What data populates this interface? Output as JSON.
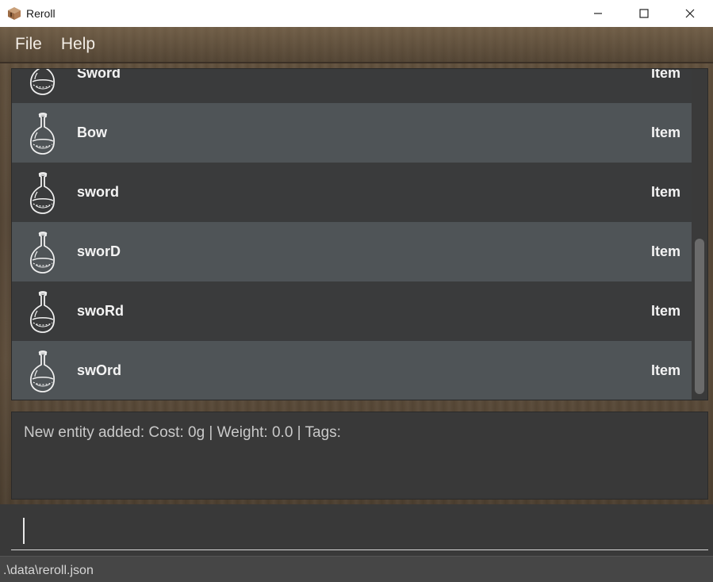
{
  "window": {
    "title": "Reroll",
    "icon": "package-box-icon"
  },
  "menu": {
    "items": [
      {
        "label": "File"
      },
      {
        "label": "Help"
      }
    ]
  },
  "list": {
    "rows": [
      {
        "name": "Sword",
        "type": "Item",
        "icon": "potion-flask-icon"
      },
      {
        "name": "Bow",
        "type": "Item",
        "icon": "potion-flask-icon"
      },
      {
        "name": "sword",
        "type": "Item",
        "icon": "potion-flask-icon"
      },
      {
        "name": "sworD",
        "type": "Item",
        "icon": "potion-flask-icon"
      },
      {
        "name": "swoRd",
        "type": "Item",
        "icon": "potion-flask-icon"
      },
      {
        "name": "swOrd",
        "type": "Item",
        "icon": "potion-flask-icon"
      }
    ]
  },
  "result": {
    "message": "New entity added: Cost: 0g | Weight: 0.0 | Tags:"
  },
  "command": {
    "value": ""
  },
  "status": {
    "file_path": ".\\data\\reroll.json"
  },
  "colors": {
    "row_dark": "#3a3b3c",
    "row_light": "#4f5457",
    "text": "#f3f3f3"
  }
}
